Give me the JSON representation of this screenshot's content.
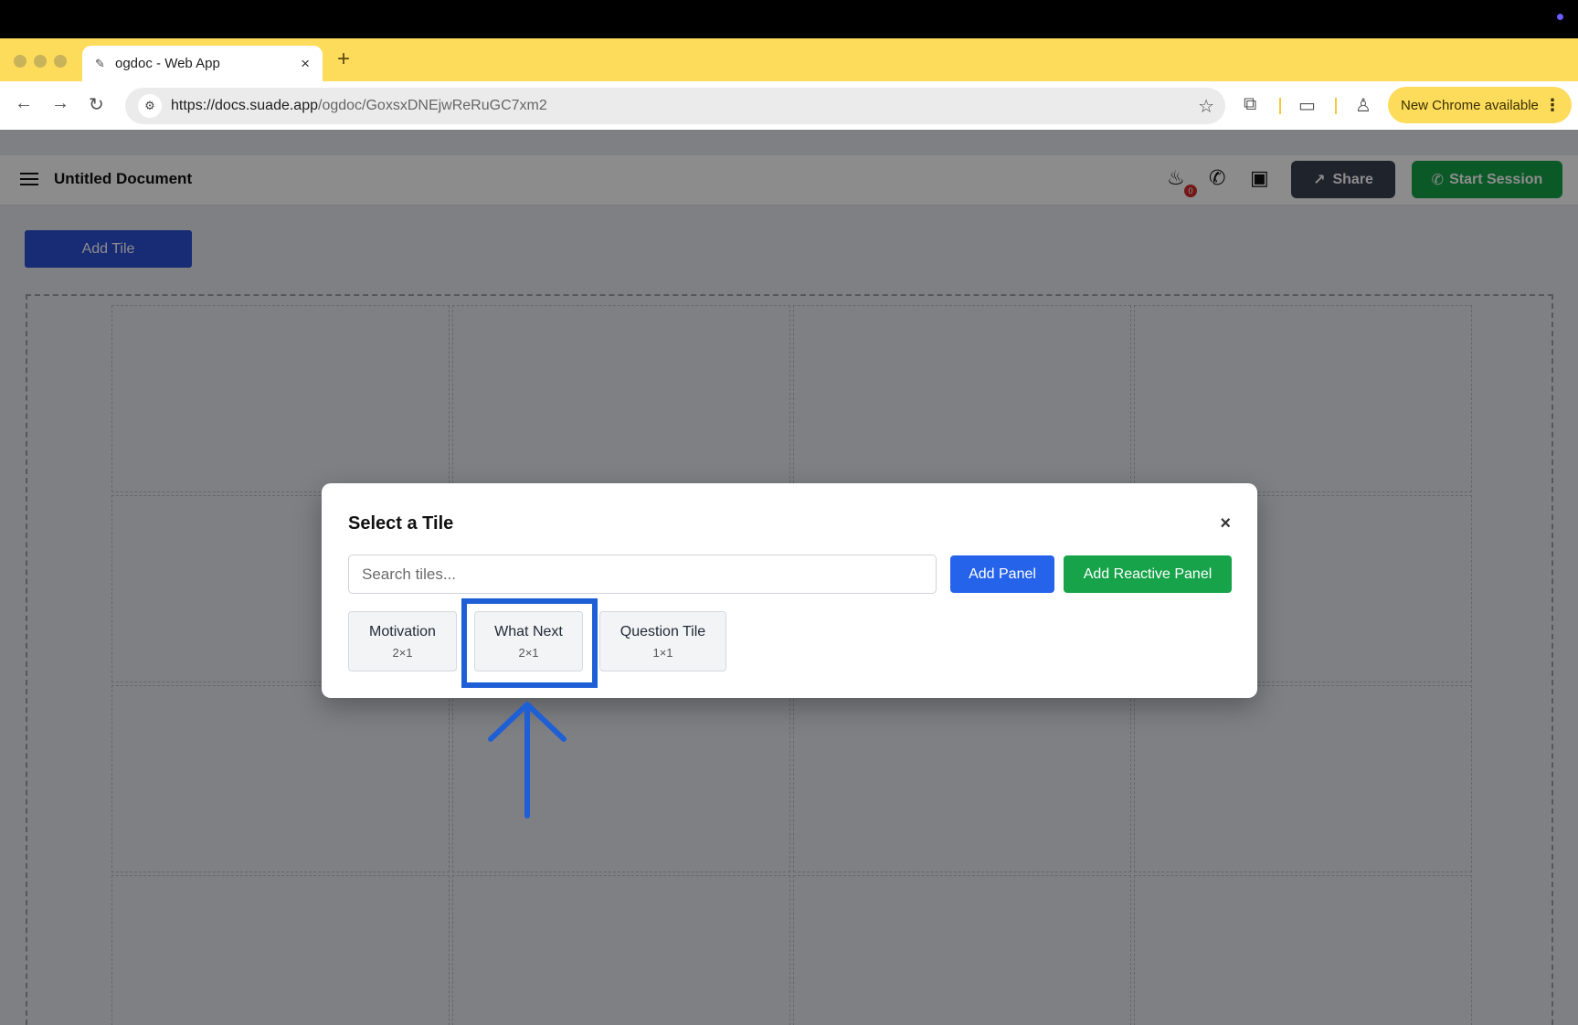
{
  "browser": {
    "tab_title": "ogdoc - Web App",
    "tab_close": "×",
    "new_tab": "+",
    "url_host": "https://docs.suade.app",
    "url_path": "/ogdoc/GoxsxDNEjwReRuGC7xm2",
    "update_label": "New Chrome available",
    "accent": "#fddc5c"
  },
  "app": {
    "doc_title": "Untitled Document",
    "notification_count": "0",
    "share_label": "Share",
    "start_session_label": "Start Session",
    "add_tile_label": "Add Tile"
  },
  "modal": {
    "title": "Select a Tile",
    "close": "×",
    "search_placeholder": "Search tiles...",
    "add_panel_label": "Add Panel",
    "add_reactive_panel_label": "Add Reactive Panel",
    "tiles": [
      {
        "name": "Motivation",
        "size": "2×1"
      },
      {
        "name": "What Next",
        "size": "2×1"
      },
      {
        "name": "Question Tile",
        "size": "1×1"
      }
    ]
  },
  "colors": {
    "primary_blue": "#2563eb",
    "success_green": "#16a34a",
    "highlight": "#1f5fd6"
  }
}
